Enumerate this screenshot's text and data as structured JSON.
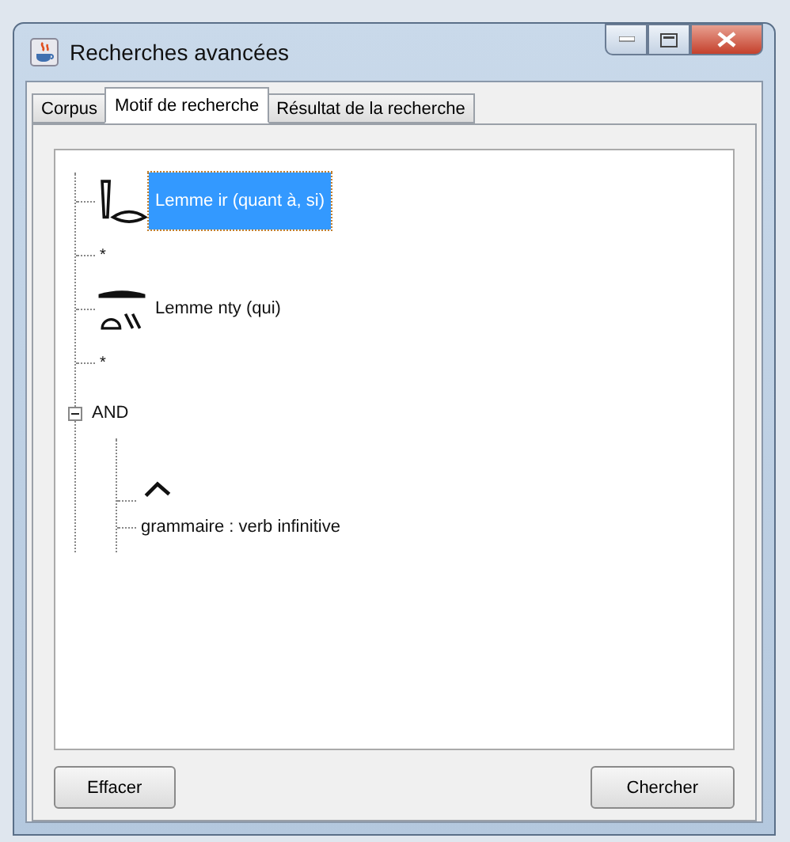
{
  "window": {
    "title": "Recherches avancées"
  },
  "tabs": [
    {
      "label": "Corpus",
      "selected": false
    },
    {
      "label": "Motif de recherche",
      "selected": true
    },
    {
      "label": "Résultat de la recherche",
      "selected": false
    }
  ],
  "tree": [
    {
      "kind": "lemma",
      "label": "Lemme ir (quant à, si)",
      "selected": true
    },
    {
      "kind": "wildcard",
      "label": "*",
      "selected": false
    },
    {
      "kind": "lemma",
      "label": "Lemme nty (qui)",
      "selected": false
    },
    {
      "kind": "wildcard",
      "label": "*",
      "selected": false
    },
    {
      "kind": "group",
      "label": "AND",
      "selected": false,
      "expanded": true,
      "children": [
        {
          "kind": "glyph",
          "selected": false
        },
        {
          "kind": "grammar",
          "label": "grammaire : verb infinitive",
          "selected": false
        }
      ]
    }
  ],
  "buttons": [
    {
      "label": "Effacer"
    },
    {
      "label": "Chercher"
    }
  ]
}
